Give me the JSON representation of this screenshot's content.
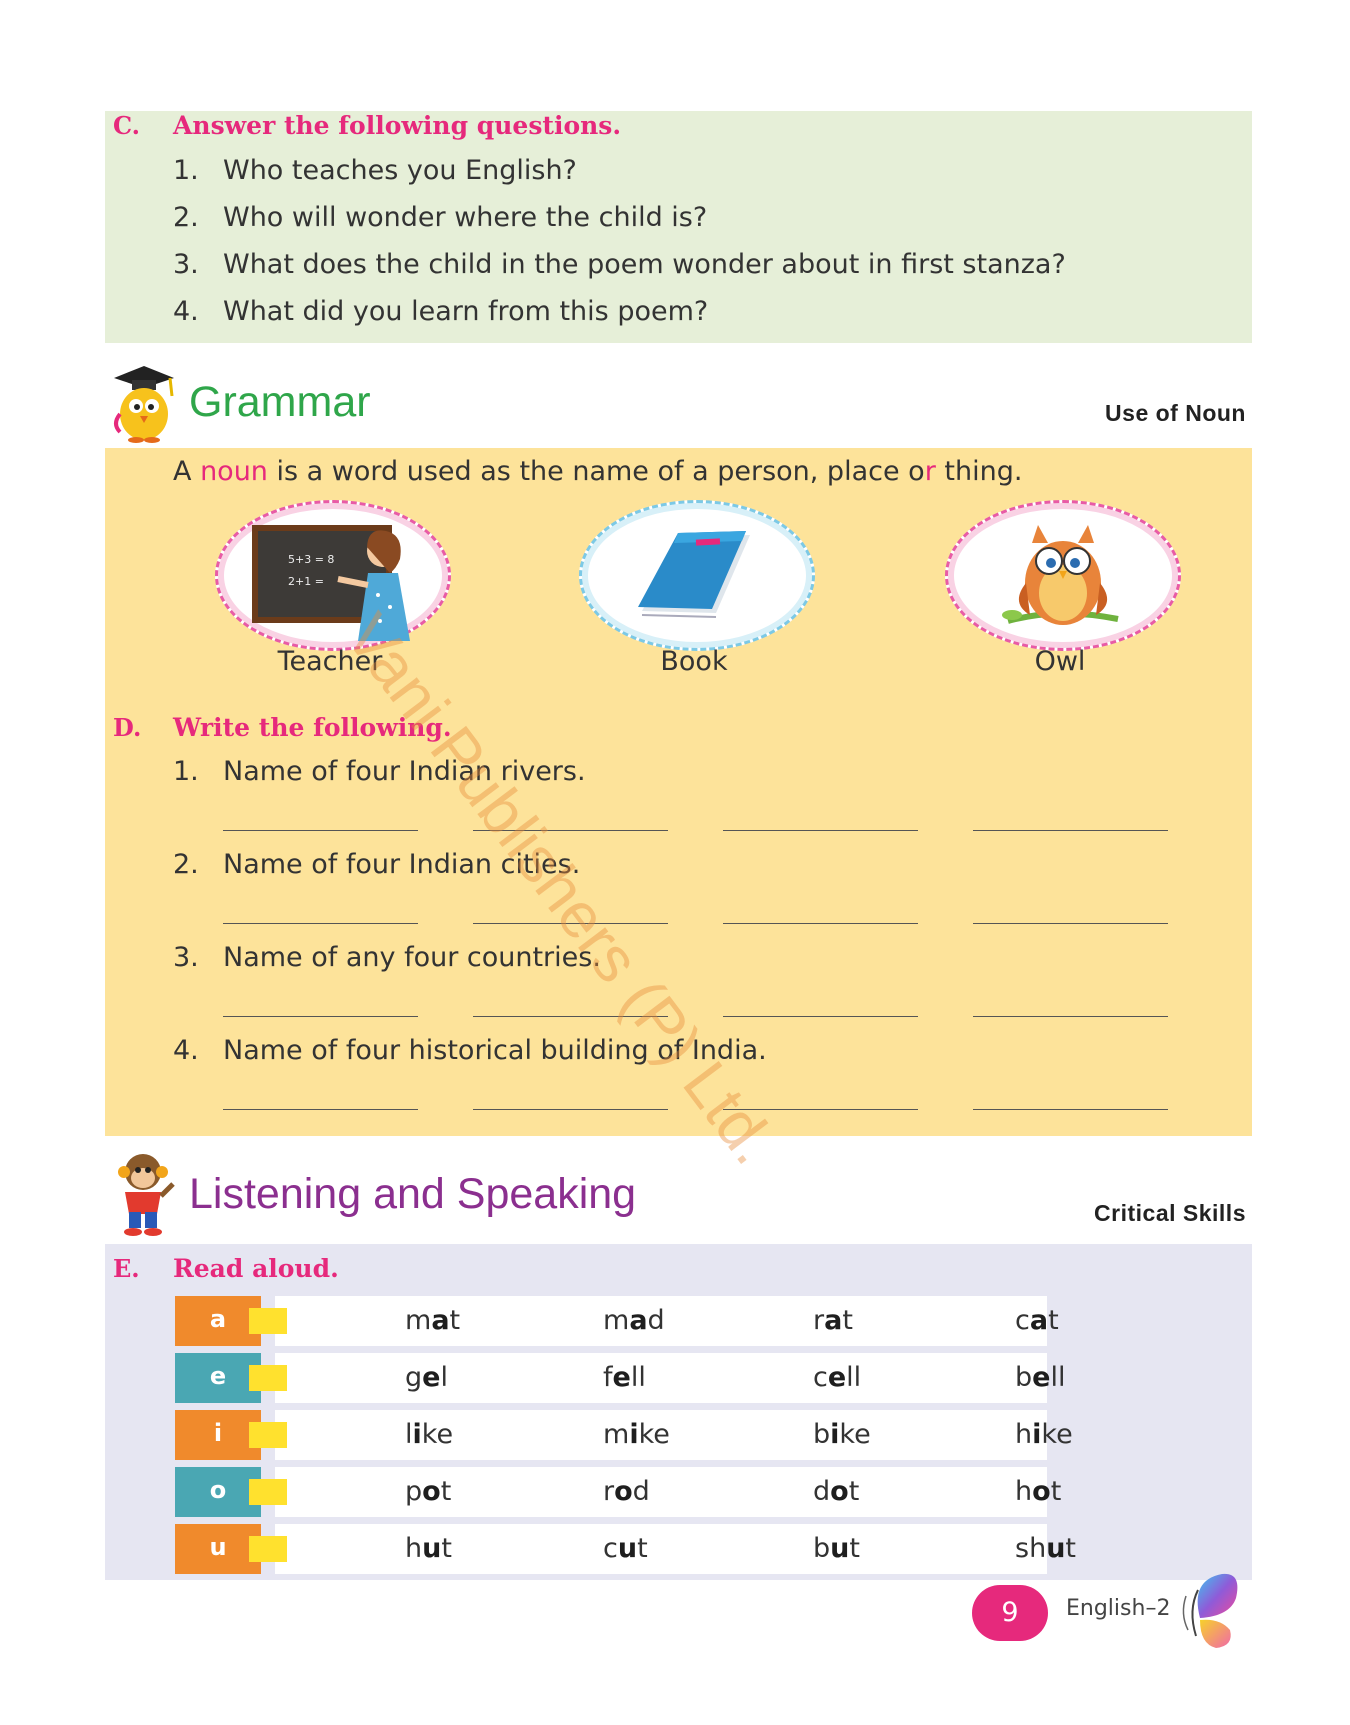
{
  "section_c": {
    "letter": "C.",
    "title": "Answer the following questions.",
    "questions": [
      {
        "num": "1.",
        "text": "Who teaches you English?"
      },
      {
        "num": "2.",
        "text": "Who will wonder where the child is?"
      },
      {
        "num": "3.",
        "text": "What does the child in the poem wonder about in first stanza?"
      },
      {
        "num": "4.",
        "text": "What did you learn from this poem?"
      }
    ]
  },
  "grammar": {
    "title": "Grammar",
    "tag": "Use of Noun",
    "definition": {
      "pre": "A ",
      "noun": "noun",
      "mid": " is a word used as the name of a person, place o",
      "r": "r",
      "post": " thing."
    },
    "pictures": [
      {
        "label": "Teacher",
        "icon": "teacher-at-blackboard-icon"
      },
      {
        "label": "Book",
        "icon": "book-icon"
      },
      {
        "label": "Owl",
        "icon": "owl-icon"
      }
    ]
  },
  "section_d": {
    "letter": "D.",
    "title": "Write the following.",
    "items": [
      {
        "num": "1.",
        "text": "Name of four Indian rivers."
      },
      {
        "num": "2.",
        "text": "Name of four Indian cities."
      },
      {
        "num": "3.",
        "text": "Name of any four countries."
      },
      {
        "num": "4.",
        "text": "Name of four historical building of India."
      }
    ]
  },
  "listening": {
    "title": "Listening and Speaking",
    "tag": "Critical Skills"
  },
  "section_e": {
    "letter": "E.",
    "title": "Read aloud.",
    "rows": [
      {
        "vowel": "a",
        "color": "#f08a2c",
        "words": [
          [
            "m",
            "a",
            "t"
          ],
          [
            "m",
            "a",
            "d"
          ],
          [
            "r",
            "a",
            "t"
          ],
          [
            "c",
            "a",
            "t"
          ]
        ]
      },
      {
        "vowel": "e",
        "color": "#4aa7b3",
        "words": [
          [
            "g",
            "e",
            "l"
          ],
          [
            "f",
            "e",
            "ll"
          ],
          [
            "c",
            "e",
            "ll"
          ],
          [
            "b",
            "e",
            "ll"
          ]
        ]
      },
      {
        "vowel": "i",
        "color": "#f08a2c",
        "words": [
          [
            "l",
            "i",
            "ke"
          ],
          [
            "m",
            "i",
            "ke"
          ],
          [
            "b",
            "i",
            "ke"
          ],
          [
            "h",
            "i",
            "ke"
          ]
        ]
      },
      {
        "vowel": "o",
        "color": "#4aa7b3",
        "words": [
          [
            "p",
            "o",
            "t"
          ],
          [
            "r",
            "o",
            "d"
          ],
          [
            "d",
            "o",
            "t"
          ],
          [
            "h",
            "o",
            "t"
          ]
        ]
      },
      {
        "vowel": "u",
        "color": "#f08a2c",
        "words": [
          [
            "h",
            "u",
            "t"
          ],
          [
            "c",
            "u",
            "t"
          ],
          [
            "b",
            "u",
            "t"
          ],
          [
            "sh",
            "u",
            "t"
          ]
        ]
      }
    ]
  },
  "footer": {
    "page": "9",
    "book": "English–2",
    "icon": "butterfly-icon"
  },
  "watermark": "Vani Publishers (P) Ltd."
}
